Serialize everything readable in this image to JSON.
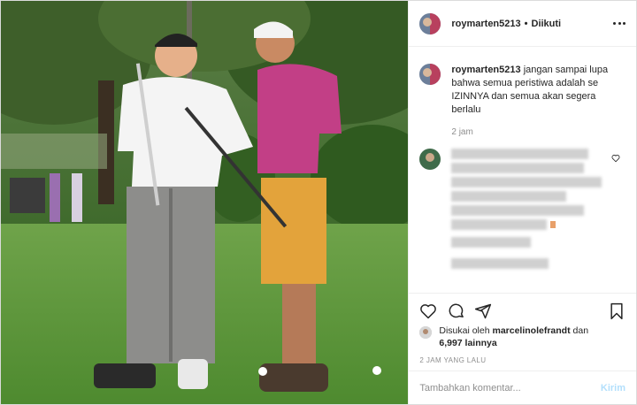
{
  "post": {
    "author": {
      "username": "roymarten5213",
      "follow_status": "Diikuti",
      "separator": "•"
    },
    "caption": {
      "username": "roymarten5213",
      "text": "jangan sampai lupa bahwa semua peristiwa adalah se IZINNYA dan semua akan segera berlalu",
      "time": "2 jam"
    },
    "likes": {
      "prefix": "Disukai oleh",
      "liker": "marcelinolefrandt",
      "conjunction": "dan",
      "count": "6,997 lainnya"
    },
    "timestamp": "2 JAM YANG LALU",
    "add_comment": {
      "placeholder": "Tambahkan komentar...",
      "post_label": "Kirim"
    },
    "icons": {
      "like": "heart-icon",
      "comment": "comment-icon",
      "share": "share-icon",
      "save": "bookmark-icon",
      "more": "more-options-icon"
    },
    "colors": {
      "post_button": "#b2dffc",
      "muted": "#8e8e8e",
      "text": "#262626"
    }
  }
}
